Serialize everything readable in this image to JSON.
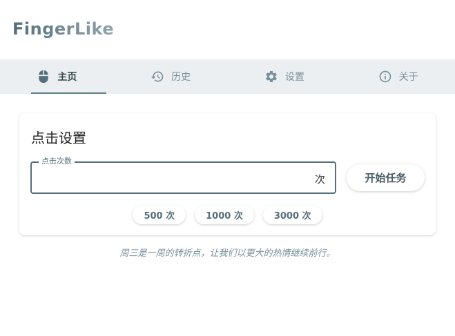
{
  "app": {
    "title": "FingerLike"
  },
  "tabs": [
    {
      "label": "主页",
      "icon": "mouse-icon",
      "active": true
    },
    {
      "label": "历史",
      "icon": "history-icon",
      "active": false
    },
    {
      "label": "设置",
      "icon": "gear-icon",
      "active": false
    },
    {
      "label": "关于",
      "icon": "info-icon",
      "active": false
    }
  ],
  "card": {
    "title": "点击设置",
    "count_field": {
      "label": "点击次数",
      "value": "",
      "suffix": "次"
    },
    "start_button": "开始任务",
    "presets": [
      "500 次",
      "1000 次",
      "3000 次"
    ]
  },
  "footer": {
    "motto": "周三是一周的转折点，让我们以更大的热情继续前行。"
  },
  "colors": {
    "accent": "#546e7a",
    "tabbar_bg": "#eceff1",
    "muted": "#78909c"
  }
}
